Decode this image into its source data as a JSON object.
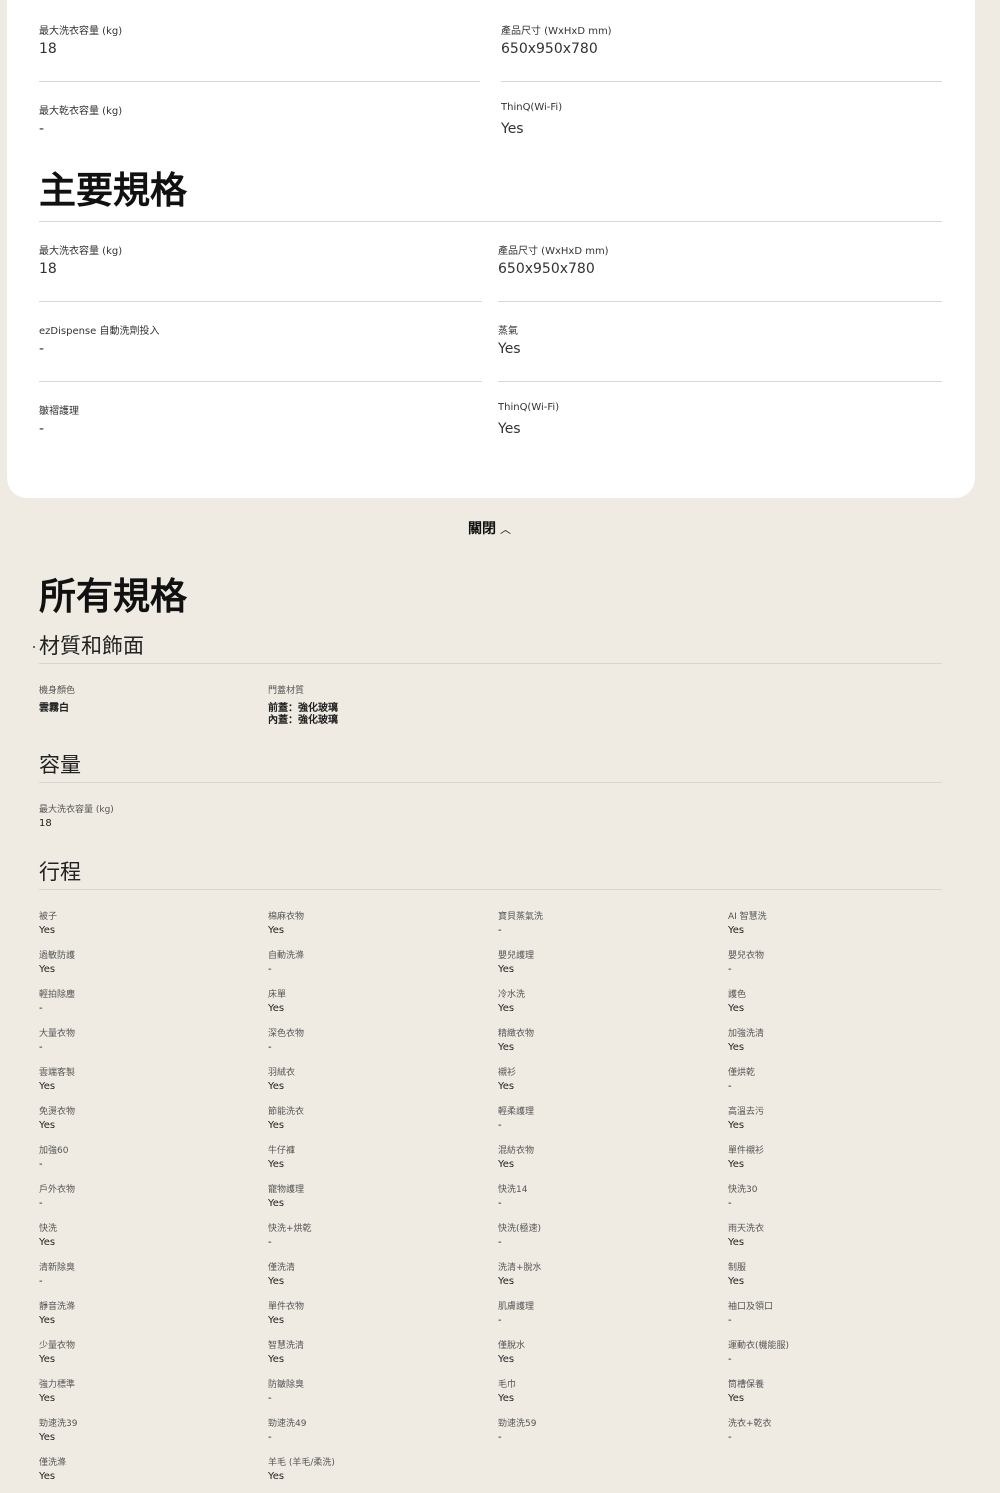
{
  "top": {
    "left_col": [
      {
        "label": "最大洗衣容量 (kg)",
        "value": "18"
      },
      {
        "label": "最大乾衣容量 (kg)",
        "value": "-"
      }
    ],
    "right_col": [
      {
        "label": "產品尺寸 (WxHxD mm)",
        "value": "650x950x780"
      },
      {
        "label": "ThinQ(Wi-Fi)",
        "value": "Yes"
      }
    ]
  },
  "key_specs": {
    "title": "主要規格",
    "left_col": [
      {
        "label": "最大洗衣容量 (kg)",
        "value": "18"
      },
      {
        "label": "ezDispense 自動洗劑投入",
        "value": "-"
      },
      {
        "label": "皺褶護理",
        "value": "-"
      }
    ],
    "right_col": [
      {
        "label": "產品尺寸 (WxHxD mm)",
        "value": "650x950x780"
      },
      {
        "label": "蒸氣",
        "value": "Yes"
      },
      {
        "label": "ThinQ(Wi-Fi)",
        "value": "Yes"
      }
    ]
  },
  "close_label": "關閉",
  "all_specs": {
    "title": "所有規格",
    "material": {
      "title": "材質和飾面",
      "body_color_label": "機身顏色",
      "body_color_value": "雲霧白",
      "door_label": "門蓋材質",
      "door_value_1": "前蓋：強化玻璃",
      "door_value_2": "內蓋：強化玻璃"
    },
    "capacity": {
      "title": "容量",
      "label": "最大洗衣容量 (kg)",
      "value": "18"
    },
    "programs": {
      "title": "行程",
      "columns": [
        [
          {
            "label": "被子",
            "value": "Yes"
          },
          {
            "label": "過敏防護",
            "value": "Yes"
          },
          {
            "label": "輕拍除塵",
            "value": "-"
          },
          {
            "label": "大量衣物",
            "value": "-"
          },
          {
            "label": "雲端客製",
            "value": "Yes"
          },
          {
            "label": "免燙衣物",
            "value": "Yes"
          },
          {
            "label": "加強60",
            "value": "-"
          },
          {
            "label": "戶外衣物",
            "value": "-"
          },
          {
            "label": "快洗",
            "value": "Yes"
          },
          {
            "label": "清新除臭",
            "value": "-"
          },
          {
            "label": "靜音洗滌",
            "value": "Yes"
          },
          {
            "label": "少量衣物",
            "value": "Yes"
          },
          {
            "label": "強力標準",
            "value": "Yes"
          },
          {
            "label": "勁速洗39",
            "value": "Yes"
          },
          {
            "label": "僅洗滌",
            "value": "Yes"
          }
        ],
        [
          {
            "label": "棉麻衣物",
            "value": "Yes"
          },
          {
            "label": "自動洗滌",
            "value": "-"
          },
          {
            "label": "床單",
            "value": "Yes"
          },
          {
            "label": "深色衣物",
            "value": "-"
          },
          {
            "label": "羽絨衣",
            "value": "Yes"
          },
          {
            "label": "節能洗衣",
            "value": "Yes"
          },
          {
            "label": "牛仔褲",
            "value": "Yes"
          },
          {
            "label": "寵物護理",
            "value": "Yes"
          },
          {
            "label": "快洗+烘乾",
            "value": "-"
          },
          {
            "label": "僅洗清",
            "value": "Yes"
          },
          {
            "label": "單件衣物",
            "value": "Yes"
          },
          {
            "label": "智慧洗清",
            "value": "Yes"
          },
          {
            "label": "防皺除臭",
            "value": "-"
          },
          {
            "label": "勁速洗49",
            "value": "-"
          },
          {
            "label": "羊毛 (羊毛/柔洗)",
            "value": "Yes"
          }
        ],
        [
          {
            "label": "寶貝蒸氣洗",
            "value": "-"
          },
          {
            "label": "嬰兒護理",
            "value": "Yes"
          },
          {
            "label": "冷水洗",
            "value": "Yes"
          },
          {
            "label": "精緻衣物",
            "value": "Yes"
          },
          {
            "label": "襯衫",
            "value": "Yes"
          },
          {
            "label": "輕柔護理",
            "value": "-"
          },
          {
            "label": "混紡衣物",
            "value": "Yes"
          },
          {
            "label": "快洗14",
            "value": "-"
          },
          {
            "label": "快洗(極速)",
            "value": "-"
          },
          {
            "label": "洗清+脫水",
            "value": "Yes"
          },
          {
            "label": "肌膚護理",
            "value": "-"
          },
          {
            "label": "僅脫水",
            "value": "Yes"
          },
          {
            "label": "毛巾",
            "value": "Yes"
          },
          {
            "label": "勁速洗59",
            "value": "-"
          }
        ],
        [
          {
            "label": "AI 智慧洗",
            "value": "Yes"
          },
          {
            "label": "嬰兒衣物",
            "value": "-"
          },
          {
            "label": "護色",
            "value": "Yes"
          },
          {
            "label": "加強洗清",
            "value": "Yes"
          },
          {
            "label": "僅烘乾",
            "value": "-"
          },
          {
            "label": "高溫去污",
            "value": "Yes"
          },
          {
            "label": "單件襯衫",
            "value": "Yes"
          },
          {
            "label": "快洗30",
            "value": "-"
          },
          {
            "label": "雨天洗衣",
            "value": "Yes"
          },
          {
            "label": "制服",
            "value": "Yes"
          },
          {
            "label": "袖口及領口",
            "value": "-"
          },
          {
            "label": "運動衣(機能服)",
            "value": "-"
          },
          {
            "label": "筒槽保養",
            "value": "Yes"
          },
          {
            "label": "洗衣+乾衣",
            "value": "-"
          }
        ]
      ]
    }
  }
}
